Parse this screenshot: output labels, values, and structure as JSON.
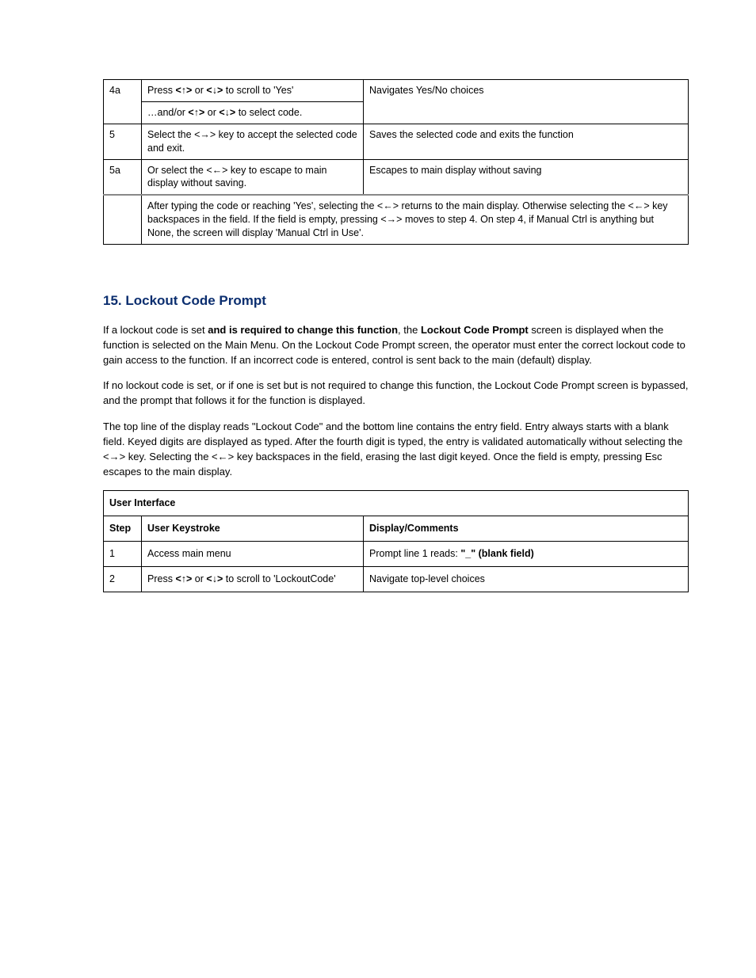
{
  "table1": {
    "row1": {
      "step": "4a",
      "action_pre": "Press ",
      "action_mid": " or ",
      "action_post": " to scroll to 'Yes'",
      "result": "Navigates Yes/No choices"
    },
    "row1b": {
      "action_lead": "…and/or ",
      "action_mid": " or ",
      "action_post": " to select code."
    },
    "row2": {
      "step": "5",
      "action_lead": "Select the <",
      "action_mid": "> key to accept the selected code and exit.",
      "result": "Saves the selected code and exits the function"
    },
    "row3": {
      "step": "5a",
      "action_lead": "Or select the <",
      "action_mid": "> key to escape to main display without saving.",
      "result": "Escapes to main display without saving"
    },
    "row4": {
      "frag1": "After typing the code or reaching 'Yes', selecting the <",
      "frag2": "> returns to the main display. Otherwise selecting the <",
      "frag3": "> key backspaces in the field. If the field is empty, pressing <",
      "frag4": "> moves to step 4. On step 4, if Manual Ctrl is anything but None, the screen will display 'Manual Ctrl in Use'."
    }
  },
  "section": {
    "title": "15.  Lockout Code Prompt"
  },
  "para1": {
    "lead": "If a lockout code is set ",
    "bold1": "and is required to change this function",
    "mid": ", the ",
    "bold2": "Lockout Code Prompt",
    "tail": " screen is displayed when the function is selected on the Main Menu. On the Lockout Code Prompt screen, the operator must enter the correct lockout code to gain access to the function. If an incorrect code is entered, control is sent back to the main (default) display."
  },
  "para2": "If no lockout code is set, or if one is set but is not required to change this function, the Lockout Code Prompt screen is bypassed, and the prompt that follows it for the function is displayed.",
  "para3": {
    "frag1": "The top line of the display reads \"Lockout Code\" and the bottom line contains the entry field. Entry always starts with a blank field. Keyed digits are displayed as typed. After the fourth digit is typed, the entry is validated automatically without selecting the <",
    "frag2": "> key. Selecting the <",
    "frag3": "> key backspaces in the field, erasing the last digit keyed. Once the field is empty, pressing Esc escapes to the main display."
  },
  "table2": {
    "header": "User Interface",
    "row0": {
      "step": "Step",
      "action": "User Keystroke",
      "display": "Display/Comments"
    },
    "row1": {
      "step": "1",
      "action": "Access main menu",
      "display_lead": "Prompt line 1 reads: ",
      "display_bold": "\"_\" (blank field)"
    },
    "row2": {
      "step": "2",
      "action_lead": "Press ",
      "action_mid": " or ",
      "action_post": " to scroll to 'LockoutCode'",
      "display": "Navigate top-level choices"
    }
  }
}
